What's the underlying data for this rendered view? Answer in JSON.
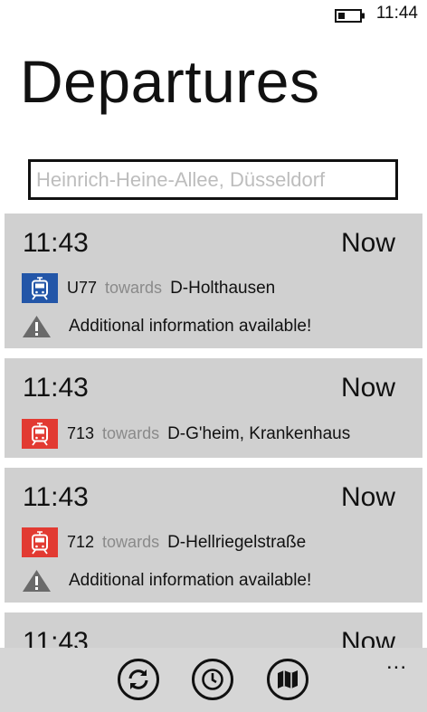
{
  "status": {
    "time": "11:44"
  },
  "page": {
    "title": "Departures"
  },
  "search": {
    "placeholder": "Heinrich-Heine-Allee, Düsseldorf"
  },
  "departures": [
    {
      "time": "11:43",
      "when": "Now",
      "line": "U77",
      "towards": "towards",
      "destination": "D-Holthausen",
      "info": "Additional information available!"
    },
    {
      "time": "11:43",
      "when": "Now",
      "line": "713",
      "towards": "towards",
      "destination": "D-G'heim, Krankenhaus"
    },
    {
      "time": "11:43",
      "when": "Now",
      "line": "712",
      "towards": "towards",
      "destination": "D-Hellriegelstraße",
      "info": "Additional information available!"
    },
    {
      "time": "11:43",
      "when": "Now"
    }
  ],
  "appbar": {
    "more": "..."
  },
  "colors": {
    "ubahn": "#2356a8",
    "tram": "#e23a32",
    "card": "#d0d0d0",
    "appbar": "#d6d6d6"
  },
  "icons": [
    "battery-icon",
    "tram-icon",
    "warning-icon",
    "refresh-icon",
    "clock-icon",
    "map-icon"
  ]
}
